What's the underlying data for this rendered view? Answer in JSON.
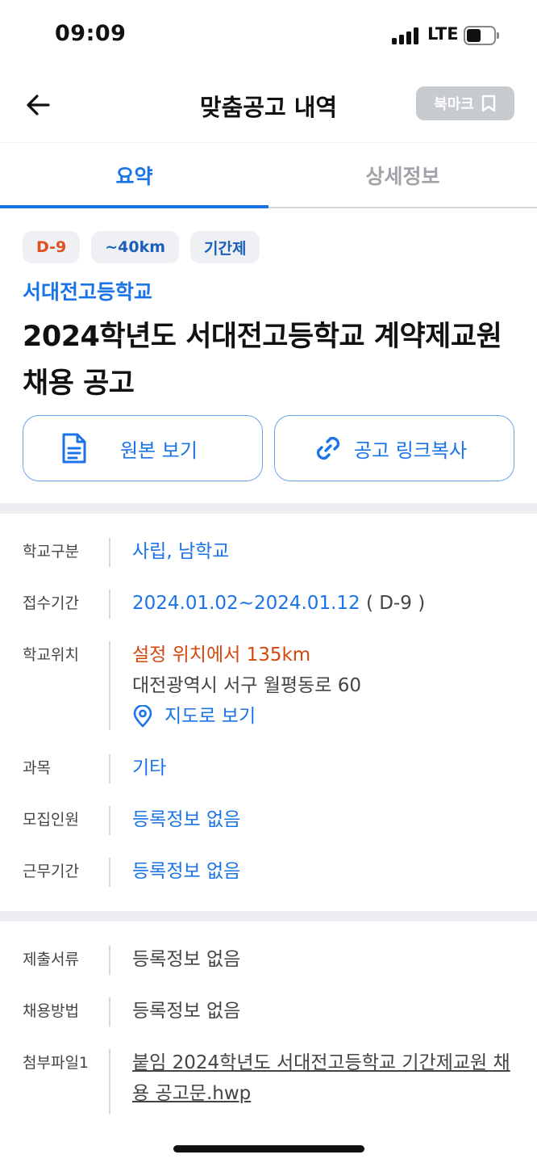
{
  "status_bar": {
    "time": "09:09",
    "network": "LTE"
  },
  "nav": {
    "title": "맞춤공고 내역",
    "bookmark_label": "북마크"
  },
  "tabs": [
    {
      "label": "요약",
      "active": true
    },
    {
      "label": "상세정보",
      "active": false
    }
  ],
  "summary": {
    "badges": [
      "D-9",
      "~40km",
      "기간제"
    ],
    "school_name": "서대전고등학교",
    "title": "2024학년도 서대전고등학교 계약제교원 채용 공고"
  },
  "actions": {
    "original_label": "원본 보기",
    "copy_link_label": "공고 링크복사"
  },
  "info": {
    "school_type": {
      "label": "학교구분",
      "value": "사립, 남학교"
    },
    "period": {
      "label": "접수기간",
      "value": "2024.01.02~2024.01.12",
      "suffix": " ( D-9 )"
    },
    "location": {
      "label": "학교위치",
      "distance": "설정 위치에서 135km",
      "address": "대전광역시 서구 월평동로 60",
      "map_label": "지도로 보기"
    },
    "subject": {
      "label": "과목",
      "value": "기타"
    },
    "recruit_count": {
      "label": "모집인원",
      "value": "등록정보 없음"
    },
    "work_period": {
      "label": "근무기간",
      "value": "등록정보 없음"
    }
  },
  "info2": {
    "documents": {
      "label": "제출서류",
      "value": "등록정보 없음"
    },
    "method": {
      "label": "채용방법",
      "value": "등록정보 없음"
    },
    "attachment": {
      "label": "첨부파일1",
      "value": "붙임 2024학년도 서대전고등학교 기간제교원 채용 공고문.hwp"
    }
  },
  "colors": {
    "accent": "#1b73e8",
    "dday": "#e0501f",
    "distance": "#d4480f"
  }
}
